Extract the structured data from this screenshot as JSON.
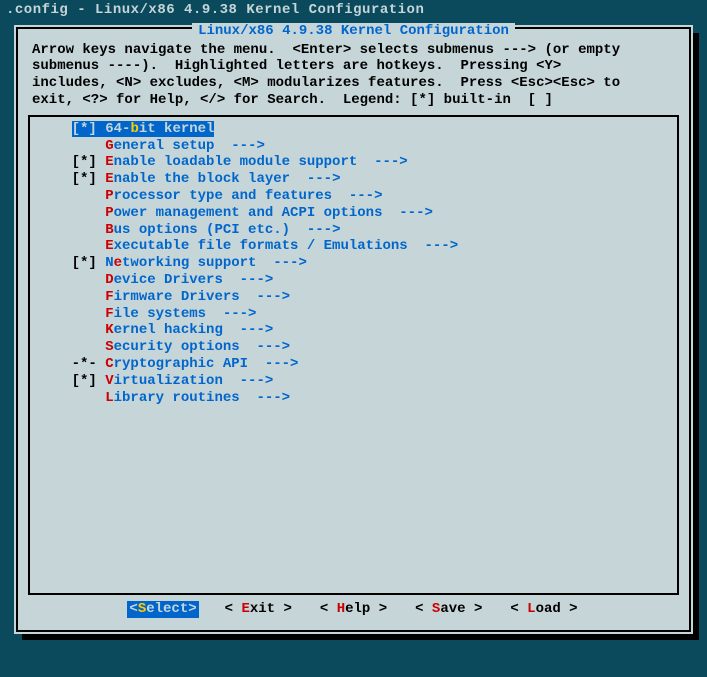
{
  "titlebar": ".config - Linux/x86 4.9.38 Kernel Configuration",
  "dialog_title": "Linux/x86 4.9.38 Kernel Configuration",
  "help_lines": [
    "Arrow keys navigate the menu.  <Enter> selects submenus ---> (or empty",
    "submenus ----).  Highlighted letters are hotkeys.  Pressing <Y>",
    "includes, <N> excludes, <M> modularizes features.  Press <Esc><Esc> to",
    "exit, <?> for Help, </> for Search.  Legend: [*] built-in  [ ]"
  ],
  "menu": [
    {
      "marker": "[*]",
      "pre": "64-",
      "hotkey": "b",
      "post": "it kernel",
      "arrow": "",
      "selected": true
    },
    {
      "marker": "   ",
      "pre": "",
      "hotkey": "G",
      "post": "eneral setup",
      "arrow": "  --->",
      "selected": false
    },
    {
      "marker": "[*]",
      "pre": "",
      "hotkey": "E",
      "post": "nable loadable module support",
      "arrow": "  --->",
      "selected": false
    },
    {
      "marker": "[*]",
      "pre": "",
      "hotkey": "E",
      "post": "nable the block layer",
      "arrow": "  --->",
      "selected": false
    },
    {
      "marker": "   ",
      "pre": "",
      "hotkey": "P",
      "post": "rocessor type and features",
      "arrow": "  --->",
      "selected": false
    },
    {
      "marker": "   ",
      "pre": "",
      "hotkey": "P",
      "post": "ower management and ACPI options",
      "arrow": "  --->",
      "selected": false
    },
    {
      "marker": "   ",
      "pre": "",
      "hotkey": "B",
      "post": "us options (PCI etc.)",
      "arrow": "  --->",
      "selected": false
    },
    {
      "marker": "   ",
      "pre": "",
      "hotkey": "E",
      "post": "xecutable file formats / Emulations",
      "arrow": "  --->",
      "selected": false
    },
    {
      "marker": "[*]",
      "pre": "N",
      "hotkey": "e",
      "post": "tworking support",
      "arrow": "  --->",
      "selected": false
    },
    {
      "marker": "   ",
      "pre": "",
      "hotkey": "D",
      "post": "evice Drivers",
      "arrow": "  --->",
      "selected": false
    },
    {
      "marker": "   ",
      "pre": "",
      "hotkey": "F",
      "post": "irmware Drivers",
      "arrow": "  --->",
      "selected": false
    },
    {
      "marker": "   ",
      "pre": "",
      "hotkey": "F",
      "post": "ile systems",
      "arrow": "  --->",
      "selected": false
    },
    {
      "marker": "   ",
      "pre": "",
      "hotkey": "K",
      "post": "ernel hacking",
      "arrow": "  --->",
      "selected": false
    },
    {
      "marker": "   ",
      "pre": "",
      "hotkey": "S",
      "post": "ecurity options",
      "arrow": "  --->",
      "selected": false
    },
    {
      "marker": "-*-",
      "pre": "",
      "hotkey": "C",
      "post": "ryptographic API",
      "arrow": "  --->",
      "selected": false
    },
    {
      "marker": "[*]",
      "pre": "",
      "hotkey": "V",
      "post": "irtualization",
      "arrow": "  --->",
      "selected": false
    },
    {
      "marker": "   ",
      "pre": "",
      "hotkey": "L",
      "post": "ibrary routines",
      "arrow": "  --->",
      "selected": false
    }
  ],
  "buttons": [
    {
      "open": "<",
      "hotkey": "S",
      "label": "elect",
      "close": ">",
      "selected": true
    },
    {
      "open": "< ",
      "hotkey": "E",
      "label": "xit ",
      "close": ">",
      "selected": false
    },
    {
      "open": "< ",
      "hotkey": "H",
      "label": "elp ",
      "close": ">",
      "selected": false
    },
    {
      "open": "< ",
      "hotkey": "S",
      "label": "ave ",
      "close": ">",
      "selected": false
    },
    {
      "open": "< ",
      "hotkey": "L",
      "label": "oad ",
      "close": ">",
      "selected": false
    }
  ]
}
